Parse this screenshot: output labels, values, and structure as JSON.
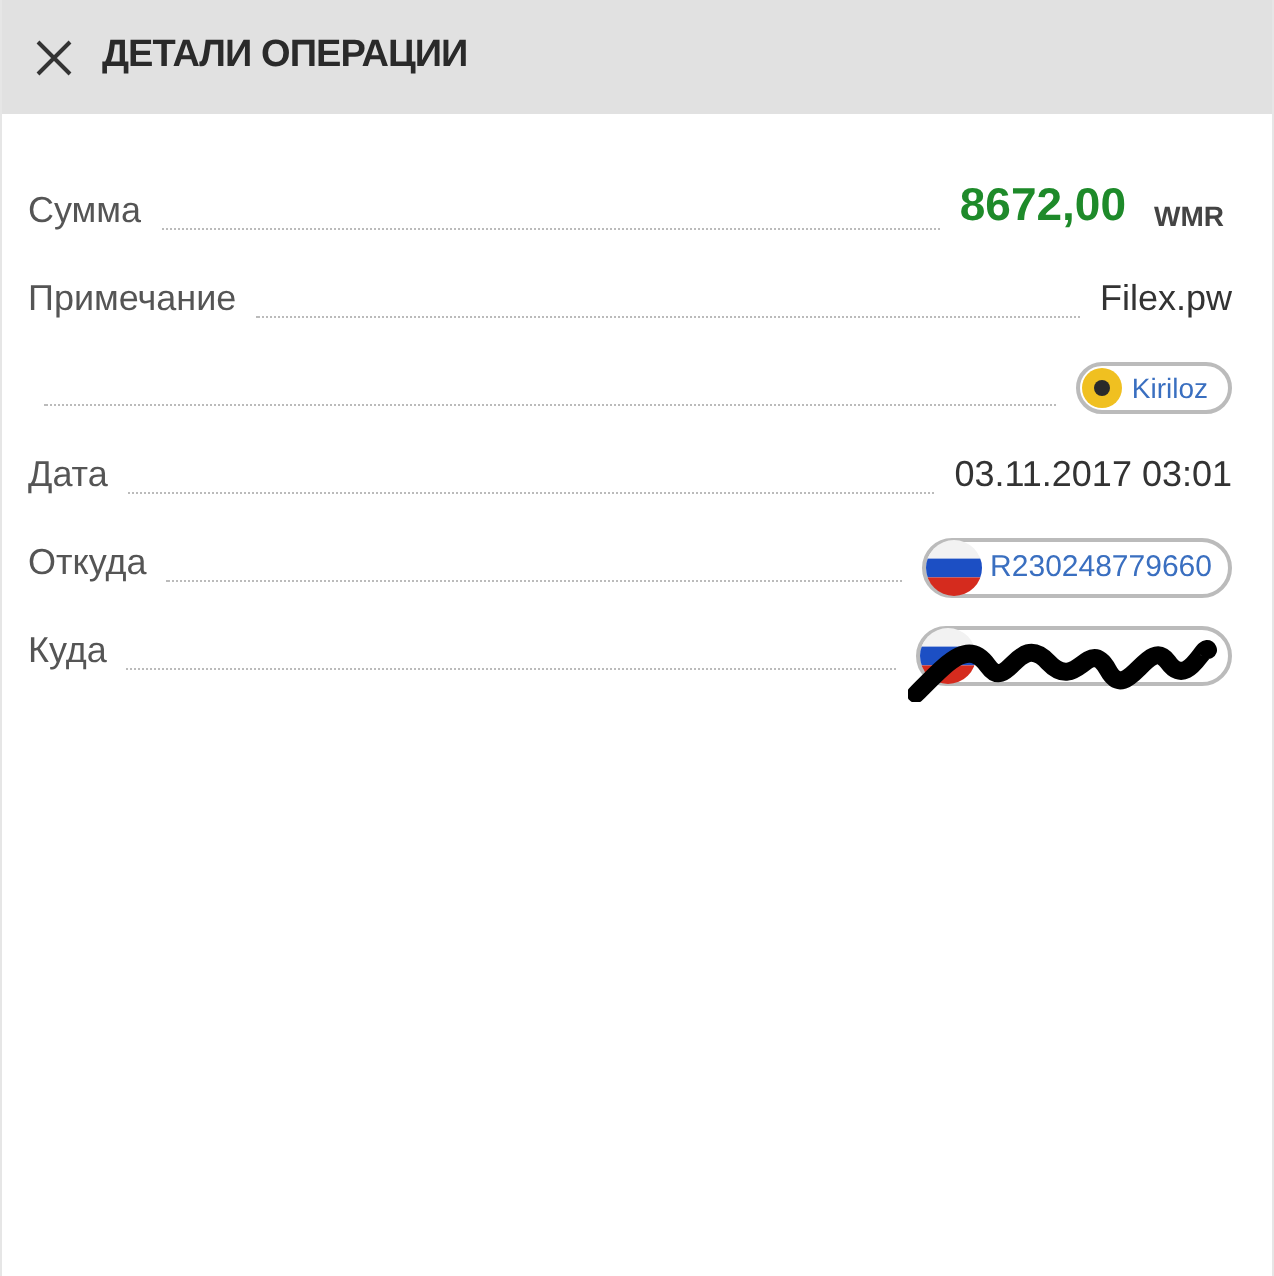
{
  "header": {
    "title": "ДЕТАЛИ ОПЕРАЦИИ"
  },
  "rows": [
    {
      "kind": "amount",
      "label": "Сумма",
      "value": "8672,00",
      "currency": "WMR"
    },
    {
      "kind": "text",
      "label": "Примечание",
      "value": "Filex.pw"
    },
    {
      "kind": "user",
      "value": "Kiriloz"
    },
    {
      "kind": "text",
      "label": "Дата",
      "value": "03.11.2017 03:01"
    },
    {
      "kind": "purse",
      "label": "Откуда",
      "value": "R230248779660"
    },
    {
      "kind": "redacted",
      "label": "Куда"
    }
  ]
}
